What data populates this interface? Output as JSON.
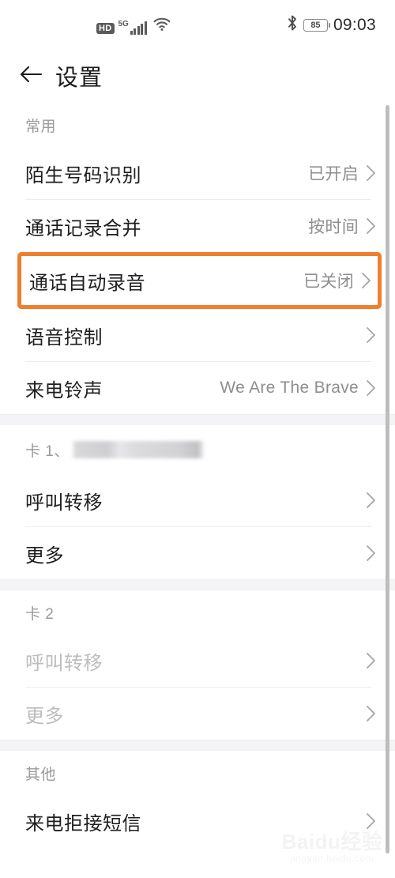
{
  "statusbar": {
    "hd_label": "HD",
    "network_label": "5G",
    "signal_icon": "signal-bars-icon",
    "wifi_icon": "wifi-icon",
    "bluetooth_icon": "bluetooth-icon",
    "battery_level": "85",
    "time": "09:03"
  },
  "appbar": {
    "back_icon": "back-arrow-icon",
    "title": "设置"
  },
  "sections": [
    {
      "header": "常用",
      "redacted": false,
      "rows": [
        {
          "label": "陌生号码识别",
          "value": "已开启",
          "disabled": false,
          "highlighted": false
        },
        {
          "label": "通话记录合并",
          "value": "按时间",
          "disabled": false,
          "highlighted": false
        },
        {
          "label": "通话自动录音",
          "value": "已关闭",
          "disabled": false,
          "highlighted": true
        },
        {
          "label": "语音控制",
          "value": "",
          "disabled": false,
          "highlighted": false
        },
        {
          "label": "来电铃声",
          "value": "We Are The Brave",
          "disabled": false,
          "highlighted": false
        }
      ]
    },
    {
      "header": "卡 1、",
      "redacted": true,
      "rows": [
        {
          "label": "呼叫转移",
          "value": "",
          "disabled": false,
          "highlighted": false
        },
        {
          "label": "更多",
          "value": "",
          "disabled": false,
          "highlighted": false
        }
      ]
    },
    {
      "header": "卡 2",
      "redacted": false,
      "rows": [
        {
          "label": "呼叫转移",
          "value": "",
          "disabled": true,
          "highlighted": false
        },
        {
          "label": "更多",
          "value": "",
          "disabled": true,
          "highlighted": false
        }
      ]
    },
    {
      "header": "其他",
      "redacted": false,
      "rows": [
        {
          "label": "来电拒接短信",
          "value": "",
          "disabled": false,
          "highlighted": false
        }
      ]
    }
  ],
  "watermark": {
    "main": "Baidu经验",
    "sub": "jingyan.baidu.com"
  },
  "colors": {
    "highlight": "#ef7f2e",
    "label": "#1e1e1e",
    "value": "#8e8e8e",
    "section_header": "#9a9a9a",
    "band": "#f4f4f6",
    "separator": "#ececec",
    "scrollbar": "#bdbdbd"
  }
}
